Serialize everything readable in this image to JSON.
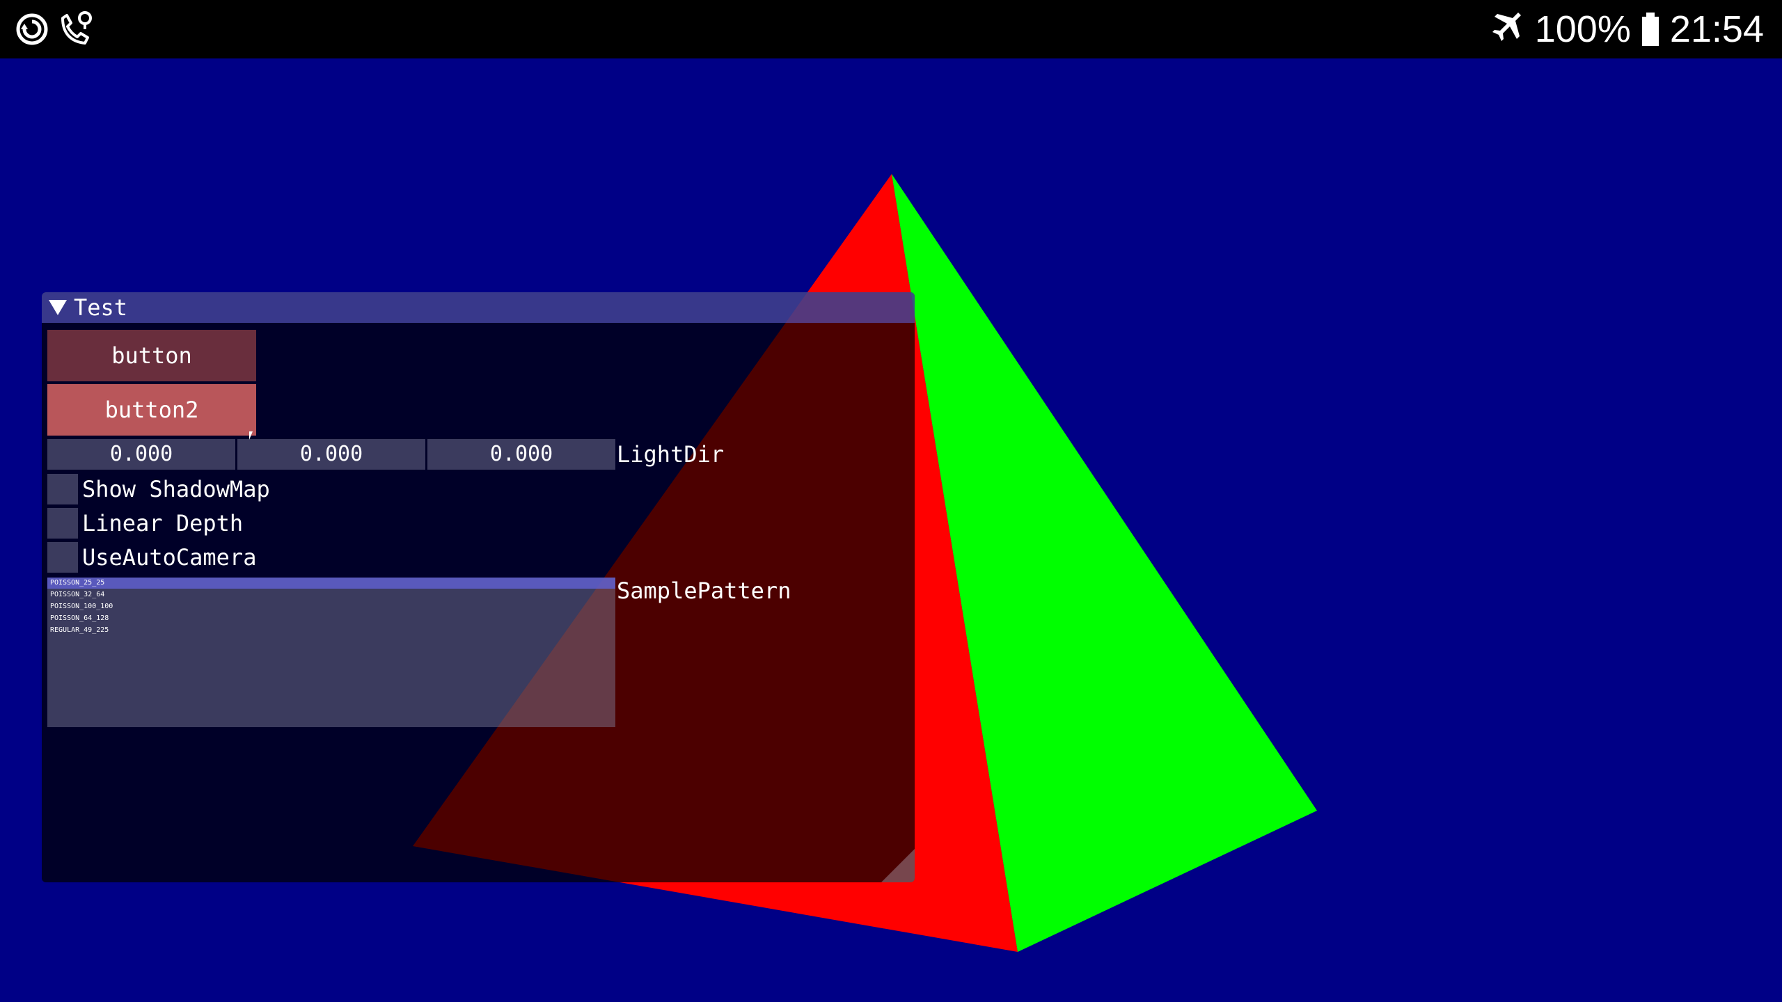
{
  "status_bar": {
    "left_icons": [
      "sync-icon",
      "wifi-calling-icon"
    ],
    "right_icons": [
      "airplane-mode-icon",
      "battery-icon"
    ],
    "battery_percent": "100%",
    "time": "21:54"
  },
  "scene": {
    "background_color": "#000086",
    "pyramid_left_face_color": "#ff0000",
    "pyramid_right_face_color": "#00ff00"
  },
  "window": {
    "title": "Test",
    "collapsed": false,
    "button1_label": "button",
    "button2_label": "button2",
    "lightdir": {
      "values": [
        "0.000",
        "0.000",
        "0.000"
      ],
      "label": "LightDir"
    },
    "checkboxes": [
      {
        "label": "Show ShadowMap",
        "checked": false
      },
      {
        "label": "Linear Depth",
        "checked": false
      },
      {
        "label": "UseAutoCamera",
        "checked": false
      }
    ],
    "samplepattern": {
      "label": "SamplePattern",
      "selected_index": 0,
      "items": [
        "POISSON_25_25",
        "POISSON_32_64",
        "POISSON_100_100",
        "POISSON_64_128",
        "REGULAR_49_225"
      ]
    }
  },
  "colors": {
    "titlebar": "#5a5ac8",
    "button": "#aa4b4b",
    "button_hovered": "#cd5f5f",
    "frame": "#8282a0",
    "list_selected": "#5f5fcd"
  }
}
